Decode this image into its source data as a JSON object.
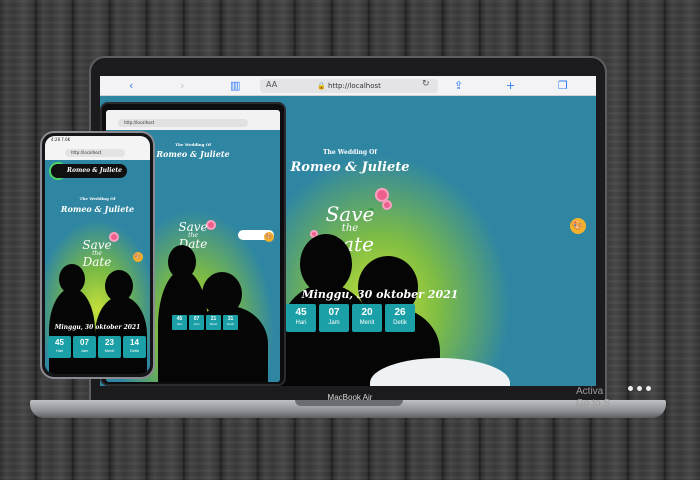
{
  "browser": {
    "url": "http://localhost",
    "text_size": "AA"
  },
  "tablet": {
    "url": "http://localhost"
  },
  "phone": {
    "status_time": "4:28 7.6K",
    "url": "http://localhost",
    "couple_chip": "Romeo & Juliete"
  },
  "invitation": {
    "wedding_of": "The Wedding Of",
    "couple": "Romeo & Juliete",
    "save": "Save",
    "the": "the",
    "date_word": "Date",
    "date": "Minggu, 30 oktober 2021"
  },
  "countdown": {
    "laptop": [
      {
        "num": "45",
        "label": "Hari"
      },
      {
        "num": "07",
        "label": "Jam"
      },
      {
        "num": "20",
        "label": "Menit"
      },
      {
        "num": "26",
        "label": "Detik"
      }
    ],
    "phone": [
      {
        "num": "45",
        "label": "Hari"
      },
      {
        "num": "07",
        "label": "Jam"
      },
      {
        "num": "23",
        "label": "Menit"
      },
      {
        "num": "14",
        "label": "Detik"
      }
    ],
    "tablet": [
      {
        "num": "45",
        "label": "Hari"
      },
      {
        "num": "07",
        "label": "Jam"
      },
      {
        "num": "21",
        "label": "Menit"
      },
      {
        "num": "31",
        "label": "Detik"
      }
    ]
  },
  "device": {
    "laptop_brand": "MacBook Air"
  },
  "watermark": {
    "line1": "Activa",
    "line2": "Go to S"
  },
  "icons": {
    "back": "chevron-left-icon",
    "forward": "chevron-right-icon",
    "bookmarks": "book-icon",
    "lock": "lock-icon",
    "reload": "reload-icon",
    "share": "share-icon",
    "new_tab": "plus-icon",
    "tabs": "tabs-icon",
    "palette": "palette-icon",
    "whatsapp": "whatsapp-icon"
  },
  "colors": {
    "accent": "#1aa0a6",
    "bg": "#2f86a3",
    "glow": "#c9e33a",
    "safari_blue": "#2d7bf4"
  }
}
